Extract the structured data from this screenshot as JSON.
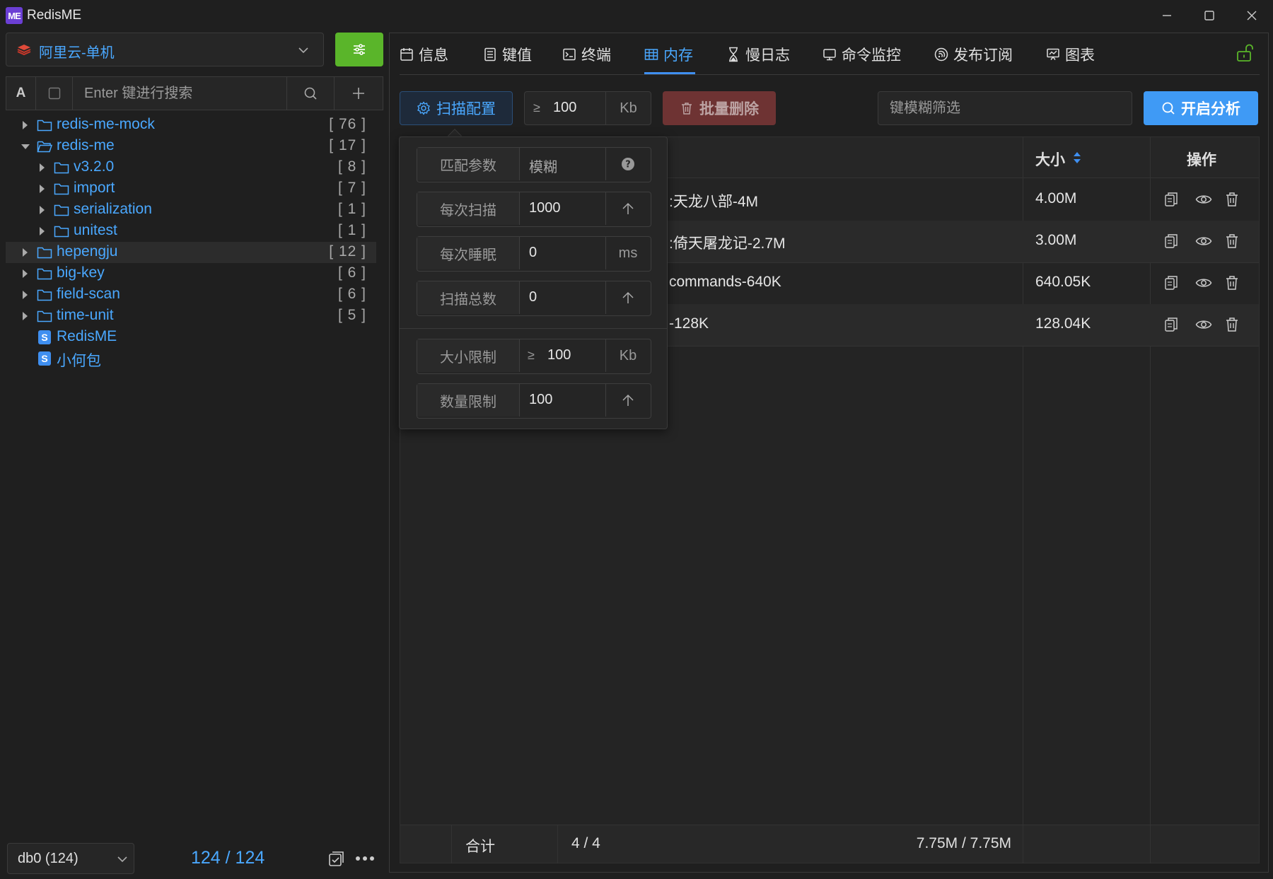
{
  "window": {
    "logo": "ME",
    "title": "RedisME"
  },
  "connection": {
    "name": "阿里云-单机"
  },
  "search": {
    "case_label": "A",
    "placeholder": "Enter 键进行搜索"
  },
  "tree": [
    {
      "label": "redis-me-mock",
      "count": "[ 76 ]"
    },
    {
      "label": "redis-me",
      "count": "[ 17 ]"
    },
    {
      "label": "v3.2.0",
      "count": "[ 8 ]"
    },
    {
      "label": "import",
      "count": "[ 7 ]"
    },
    {
      "label": "serialization",
      "count": "[ 1 ]"
    },
    {
      "label": "unitest",
      "count": "[ 1 ]"
    },
    {
      "label": "hepengju",
      "count": "[ 12 ]"
    },
    {
      "label": "big-key",
      "count": "[ 6 ]"
    },
    {
      "label": "field-scan",
      "count": "[ 6 ]"
    },
    {
      "label": "time-unit",
      "count": "[ 5 ]"
    },
    {
      "label": "RedisME",
      "badge": "S"
    },
    {
      "label": "小何包",
      "badge": "S"
    }
  ],
  "footer_left": {
    "db": "db0 (124)",
    "count": "124 / 124"
  },
  "tabs": [
    "信息",
    "键值",
    "终端",
    "内存",
    "慢日志",
    "命令监控",
    "发布订阅",
    "图表"
  ],
  "toolbar": {
    "scan_config": "扫描配置",
    "size_op": "≥",
    "size_value": "100",
    "size_unit": "Kb",
    "batch_delete": "批量删除",
    "filter_placeholder": "键模糊筛选",
    "analyze": "开启分析"
  },
  "table": {
    "col_size": "大小",
    "col_ops": "操作",
    "rows": [
      {
        "key": ":天龙八部-4M",
        "size": "4.00M"
      },
      {
        "key": ":倚天屠龙记-2.7M",
        "size": "3.00M"
      },
      {
        "key": "commands-640K",
        "size": "640.05K"
      },
      {
        "key": "-128K",
        "size": "128.04K"
      }
    ],
    "footer": {
      "label": "合计",
      "count": "4 / 4",
      "size": "7.75M / 7.75M"
    }
  },
  "popover": {
    "match_label": "匹配参数",
    "match_value": "模糊",
    "scan_label": "每次扫描",
    "scan_value": "1000",
    "sleep_label": "每次睡眠",
    "sleep_value": "0",
    "sleep_unit": "ms",
    "total_label": "扫描总数",
    "total_value": "0",
    "size_label": "大小限制",
    "size_op": "≥",
    "size_value": "100",
    "size_unit": "Kb",
    "count_label": "数量限制",
    "count_value": "100"
  },
  "colors": {
    "accent": "#3f9af5",
    "link": "#4aa8ff",
    "green": "#5ab52a",
    "danger": "#6e3333"
  }
}
